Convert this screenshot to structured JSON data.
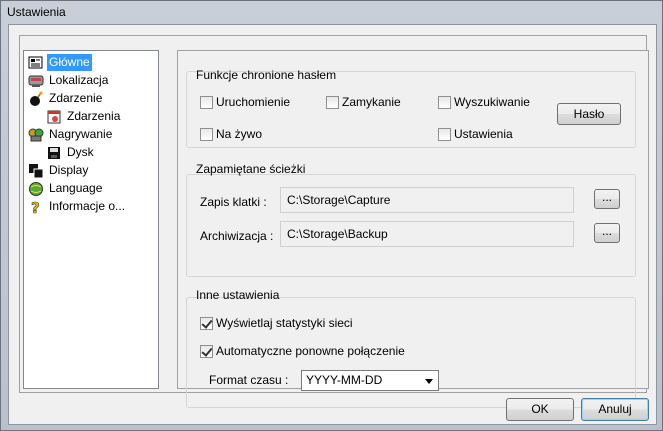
{
  "window": {
    "title": "Ustawienia"
  },
  "tree": {
    "items": [
      {
        "label": "Główne",
        "icon": "general-settings-icon"
      },
      {
        "label": "Lokalizacja",
        "icon": "location-icon"
      },
      {
        "label": "Zdarzenie",
        "icon": "event-bomb-icon"
      },
      {
        "label": "Zdarzenia",
        "icon": "events-calendar-icon"
      },
      {
        "label": "Nagrywanie",
        "icon": "recording-icon"
      },
      {
        "label": "Dysk",
        "icon": "disk-icon"
      },
      {
        "label": "Display",
        "icon": "display-icon"
      },
      {
        "label": "Language",
        "icon": "language-globe-icon"
      },
      {
        "label": "Informacje o...",
        "icon": "info-question-icon"
      }
    ]
  },
  "password": {
    "title": "Funkcje chronione hasłem",
    "startup": "Uruchomienie",
    "closing": "Zamykanie",
    "search": "Wyszukiwanie",
    "live": "Na żywo",
    "settings": "Ustawienia",
    "password_button": "Hasło"
  },
  "paths": {
    "title": "Zapamiętane ścieżki",
    "capture_label": "Zapis klatki :",
    "capture_value": "C:\\Storage\\Capture",
    "archive_label": "Archiwizacja :",
    "archive_value": "C:\\Storage\\Backup",
    "browse_label": "..."
  },
  "other": {
    "title": "Inne ustawienia",
    "network_stats": "Wyświetlaj statystyki sieci",
    "network_stats_checked": true,
    "auto_reconnect": "Automatyczne ponowne połączenie",
    "auto_reconnect_checked": true,
    "time_format_label": "Format czasu :",
    "time_format_value": "YYYY-MM-DD"
  },
  "footer": {
    "ok": "OK",
    "cancel": "Anuluj"
  }
}
